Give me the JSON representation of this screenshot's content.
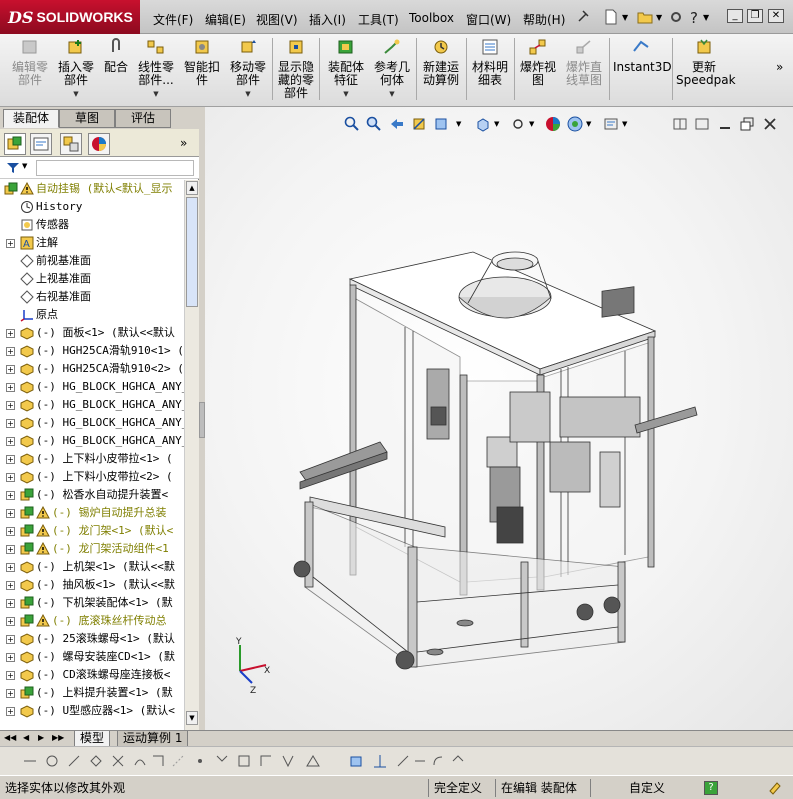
{
  "app": {
    "logo_ds": "DS",
    "logo_name": "SOLIDWORKS"
  },
  "menu": [
    {
      "label": "文件(F)"
    },
    {
      "label": "编辑(E)"
    },
    {
      "label": "视图(V)"
    },
    {
      "label": "插入(I)"
    },
    {
      "label": "工具(T)"
    },
    {
      "label": "Toolbox"
    },
    {
      "label": "窗口(W)"
    },
    {
      "label": "帮助(H)"
    }
  ],
  "command_manager": [
    {
      "label1": "编辑零",
      "label2": "部件",
      "label3": "",
      "disabled": true,
      "arrow": false
    },
    {
      "label1": "插入零",
      "label2": "部件",
      "label3": "",
      "disabled": false,
      "arrow": true
    },
    {
      "label1": "配合",
      "label2": "",
      "label3": "",
      "disabled": false,
      "arrow": false
    },
    {
      "label1": "线性零",
      "label2": "部件...",
      "label3": "",
      "disabled": false,
      "arrow": true
    },
    {
      "label1": "智能扣",
      "label2": "件",
      "label3": "",
      "disabled": false,
      "arrow": false
    },
    {
      "label1": "移动零",
      "label2": "部件",
      "label3": "",
      "disabled": false,
      "arrow": true
    },
    {
      "label1": "显示隐",
      "label2": "藏的零",
      "label3": "部件",
      "disabled": false,
      "arrow": false
    },
    {
      "label1": "装配体",
      "label2": "特征",
      "label3": "",
      "disabled": false,
      "arrow": true
    },
    {
      "label1": "参考几",
      "label2": "何体",
      "label3": "",
      "disabled": false,
      "arrow": true
    },
    {
      "label1": "新建运",
      "label2": "动算例",
      "label3": "",
      "disabled": false,
      "arrow": false
    },
    {
      "label1": "材料明",
      "label2": "细表",
      "label3": "",
      "disabled": false,
      "arrow": false
    },
    {
      "label1": "爆炸视",
      "label2": "图",
      "label3": "",
      "disabled": false,
      "arrow": false
    },
    {
      "label1": "爆炸直",
      "label2": "线草图",
      "label3": "",
      "disabled": true,
      "arrow": false
    },
    {
      "label1": "Instant3D",
      "label2": "",
      "label3": "",
      "disabled": false,
      "arrow": false
    },
    {
      "label1": "更新",
      "label2": "Speedpak",
      "label3": "",
      "disabled": false,
      "arrow": false
    }
  ],
  "command_tabs": [
    {
      "label": "装配体"
    },
    {
      "label": "草图"
    },
    {
      "label": "评估"
    }
  ],
  "tree": [
    {
      "label": "自动挂锡  (默认<默认_显示",
      "level": 0,
      "expander": "",
      "icon": "assembly",
      "warn": true
    },
    {
      "label": "History",
      "level": 1,
      "expander": "",
      "icon": "history",
      "warn": false
    },
    {
      "label": "传感器",
      "level": 1,
      "expander": "",
      "icon": "sensor",
      "warn": false
    },
    {
      "label": "注解",
      "level": 1,
      "expander": "+",
      "icon": "annotation",
      "warn": false
    },
    {
      "label": "前视基准面",
      "level": 1,
      "expander": "",
      "icon": "plane",
      "warn": false
    },
    {
      "label": "上视基准面",
      "level": 1,
      "expander": "",
      "icon": "plane",
      "warn": false
    },
    {
      "label": "右视基准面",
      "level": 1,
      "expander": "",
      "icon": "plane",
      "warn": false
    },
    {
      "label": "原点",
      "level": 1,
      "expander": "",
      "icon": "origin",
      "warn": false
    },
    {
      "label": "(-) 面板<1> (默认<<默认",
      "level": 1,
      "expander": "+",
      "icon": "part",
      "warn": false
    },
    {
      "label": "(-) HGH25CA滑轨910<1> (",
      "level": 1,
      "expander": "+",
      "icon": "part",
      "warn": false
    },
    {
      "label": "(-) HGH25CA滑轨910<2> (",
      "level": 1,
      "expander": "+",
      "icon": "part",
      "warn": false
    },
    {
      "label": "(-) HG_BLOCK_HGHCA_ANY_",
      "level": 1,
      "expander": "+",
      "icon": "part",
      "warn": false
    },
    {
      "label": "(-) HG_BLOCK_HGHCA_ANY_",
      "level": 1,
      "expander": "+",
      "icon": "part",
      "warn": false
    },
    {
      "label": "(-) HG_BLOCK_HGHCA_ANY_",
      "level": 1,
      "expander": "+",
      "icon": "part",
      "warn": false
    },
    {
      "label": "(-) HG_BLOCK_HGHCA_ANY_",
      "level": 1,
      "expander": "+",
      "icon": "part",
      "warn": false
    },
    {
      "label": "(-) 上下料小皮带拉<1> (",
      "level": 1,
      "expander": "+",
      "icon": "part",
      "warn": false
    },
    {
      "label": "(-) 上下料小皮带拉<2> (",
      "level": 1,
      "expander": "+",
      "icon": "part",
      "warn": false
    },
    {
      "label": "(-) 松香水自动提升装置<",
      "level": 1,
      "expander": "+",
      "icon": "subasm",
      "warn": false
    },
    {
      "label": "(-) 锡炉自动提升总装",
      "level": 1,
      "expander": "+",
      "icon": "subasm",
      "warn": true
    },
    {
      "label": "(-) 龙门架<1> (默认<",
      "level": 1,
      "expander": "+",
      "icon": "subasm",
      "warn": true
    },
    {
      "label": "(-) 龙门架活动组件<1",
      "level": 1,
      "expander": "+",
      "icon": "subasm",
      "warn": true
    },
    {
      "label": "(-) 上机架<1> (默认<<默",
      "level": 1,
      "expander": "+",
      "icon": "part",
      "warn": false
    },
    {
      "label": "(-) 抽风板<1> (默认<<默",
      "level": 1,
      "expander": "+",
      "icon": "part",
      "warn": false
    },
    {
      "label": "(-) 下机架装配体<1> (默",
      "level": 1,
      "expander": "+",
      "icon": "subasm",
      "warn": false
    },
    {
      "label": "(-) 底滚珠丝杆传动总",
      "level": 1,
      "expander": "+",
      "icon": "subasm",
      "warn": true
    },
    {
      "label": "(-) 25滚珠螺母<1> (默认",
      "level": 1,
      "expander": "+",
      "icon": "part",
      "warn": false
    },
    {
      "label": "(-) 螺母安装座CD<1> (默",
      "level": 1,
      "expander": "+",
      "icon": "part",
      "warn": false
    },
    {
      "label": "(-) CD滚珠螺母座连接板<",
      "level": 1,
      "expander": "+",
      "icon": "part",
      "warn": false
    },
    {
      "label": "(-) 上料提升装置<1> (默",
      "level": 1,
      "expander": "+",
      "icon": "subasm",
      "warn": false
    },
    {
      "label": "(-) U型感应器<1> (默认<",
      "level": 1,
      "expander": "+",
      "icon": "part",
      "warn": false
    }
  ],
  "bottom_tabs": [
    {
      "label": "模型"
    },
    {
      "label": "运动算例 1"
    }
  ],
  "status": {
    "message": "选择实体以修改其外观",
    "constraint": "完全定义",
    "editing": "在编辑 装配体",
    "units": "自定义",
    "help": "?"
  },
  "colors": {
    "brand": "#c8102e",
    "warn_text": "#7f7f00",
    "frame": "#b9b9b9"
  }
}
